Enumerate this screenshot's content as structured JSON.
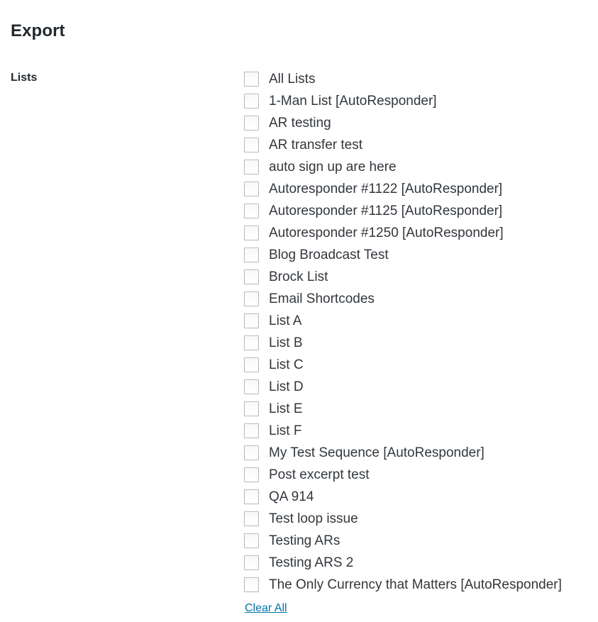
{
  "page": {
    "title": "Export",
    "background_color": "#ffffff",
    "text_color": "#32373c"
  },
  "form": {
    "field_label": "Lists",
    "checkbox_border_color": "#b4b9be",
    "link_color": "#0073aa",
    "lists": [
      {
        "label": "All Lists",
        "checked": false
      },
      {
        "label": "1-Man List [AutoResponder]",
        "checked": false
      },
      {
        "label": "AR testing",
        "checked": false
      },
      {
        "label": "AR transfer test",
        "checked": false
      },
      {
        "label": "auto sign up are here",
        "checked": false
      },
      {
        "label": "Autoresponder #1122 [AutoResponder]",
        "checked": false
      },
      {
        "label": "Autoresponder #1125 [AutoResponder]",
        "checked": false
      },
      {
        "label": "Autoresponder #1250 [AutoResponder]",
        "checked": false
      },
      {
        "label": "Blog Broadcast Test",
        "checked": false
      },
      {
        "label": "Brock List",
        "checked": false
      },
      {
        "label": "Email Shortcodes",
        "checked": false
      },
      {
        "label": "List A",
        "checked": false
      },
      {
        "label": "List B",
        "checked": false
      },
      {
        "label": "List C",
        "checked": false
      },
      {
        "label": "List D",
        "checked": false
      },
      {
        "label": "List E",
        "checked": false
      },
      {
        "label": "List F",
        "checked": false
      },
      {
        "label": "My Test Sequence [AutoResponder]",
        "checked": false
      },
      {
        "label": "Post excerpt test",
        "checked": false
      },
      {
        "label": "QA 914",
        "checked": false
      },
      {
        "label": "Test loop issue",
        "checked": false
      },
      {
        "label": "Testing ARs",
        "checked": false
      },
      {
        "label": "Testing ARS 2",
        "checked": false
      },
      {
        "label": "The Only Currency that Matters [AutoResponder]",
        "checked": false
      }
    ],
    "clear_all_label": "Clear All"
  }
}
